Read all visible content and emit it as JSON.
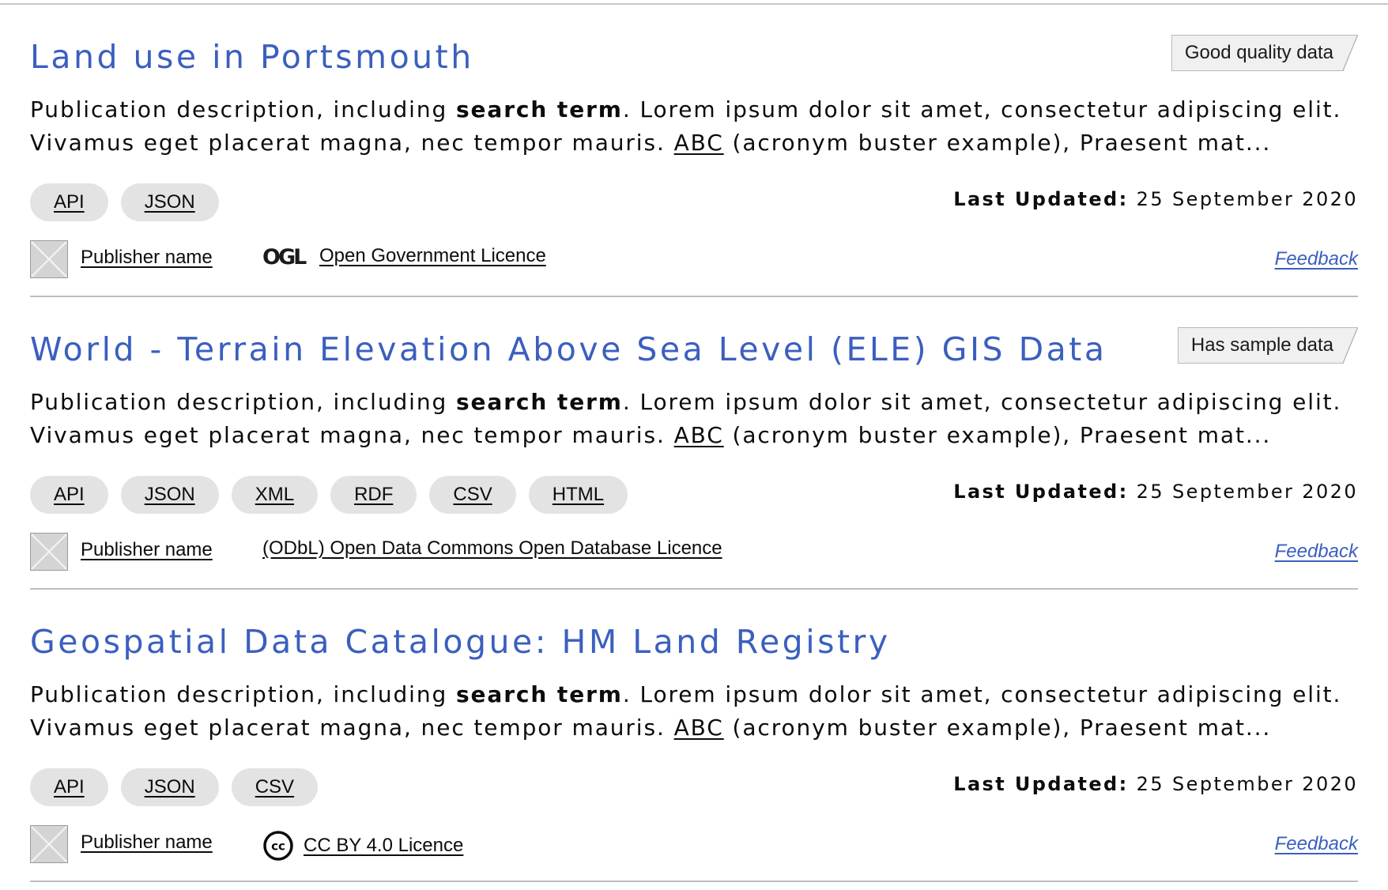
{
  "description": {
    "part1": "Publication description, including ",
    "search_term": "search term",
    "part2": ". Lorem ipsum dolor sit amet, consectetur adipiscing elit.",
    "part3": "Vivamus eget placerat magna, nec tempor mauris. ",
    "acronym": "ABC",
    "part4": " (acronym buster example), Praesent mat..."
  },
  "last_updated_label": "Last Updated:",
  "results": [
    {
      "title": "Land use in Portsmouth",
      "badge": "Good quality data",
      "formats": [
        "API",
        "JSON"
      ],
      "last_updated": "25 September 2020",
      "publisher": "Publisher name",
      "licence": "Open Government Licence",
      "licence_icon": "ogl-icon",
      "licence_icon_text": "OGL",
      "feedback": "Feedback"
    },
    {
      "title": "World - Terrain Elevation Above Sea Level (ELE) GIS Data",
      "badge": "Has sample data",
      "formats": [
        "API",
        "JSON",
        "XML",
        "RDF",
        "CSV",
        "HTML"
      ],
      "last_updated": "25 September 2020",
      "publisher": "Publisher name",
      "licence": "(ODbL) Open Data Commons Open Database Licence",
      "licence_icon": "",
      "feedback": "Feedback"
    },
    {
      "title": "Geospatial Data Catalogue: HM Land Registry",
      "badge": "",
      "formats": [
        "API",
        "JSON",
        "CSV"
      ],
      "last_updated": "25 September 2020",
      "publisher": "Publisher name",
      "licence": "CC BY 4.0 Licence",
      "licence_icon": "creative-commons-icon",
      "licence_icon_text": "cc",
      "feedback": "Feedback"
    }
  ],
  "colors": {
    "title": "#3b5fbf",
    "feedback": "#3b5fbf",
    "pill_bg": "#e3e3e3",
    "badge_bg": "#f0f0f0",
    "divider": "#bdbdbd"
  }
}
